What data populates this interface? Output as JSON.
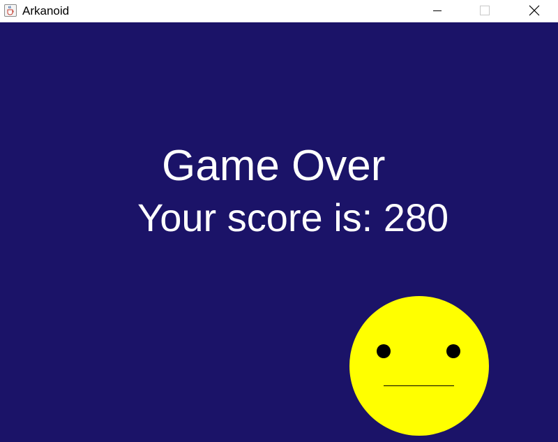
{
  "window": {
    "title": "Arkanoid",
    "app_icon": "java-cup-icon",
    "controls": [
      "minimize-icon",
      "maximize-icon",
      "close-icon"
    ]
  },
  "game": {
    "background_color": "#1b1368",
    "text_color": "#ffffff",
    "game_over_text": "Game Over",
    "score_label": "Your score is:",
    "score_value": "280",
    "face": {
      "icon": "neutral-face-icon",
      "face_color": "#ffff00",
      "feature_color": "#000000"
    }
  }
}
